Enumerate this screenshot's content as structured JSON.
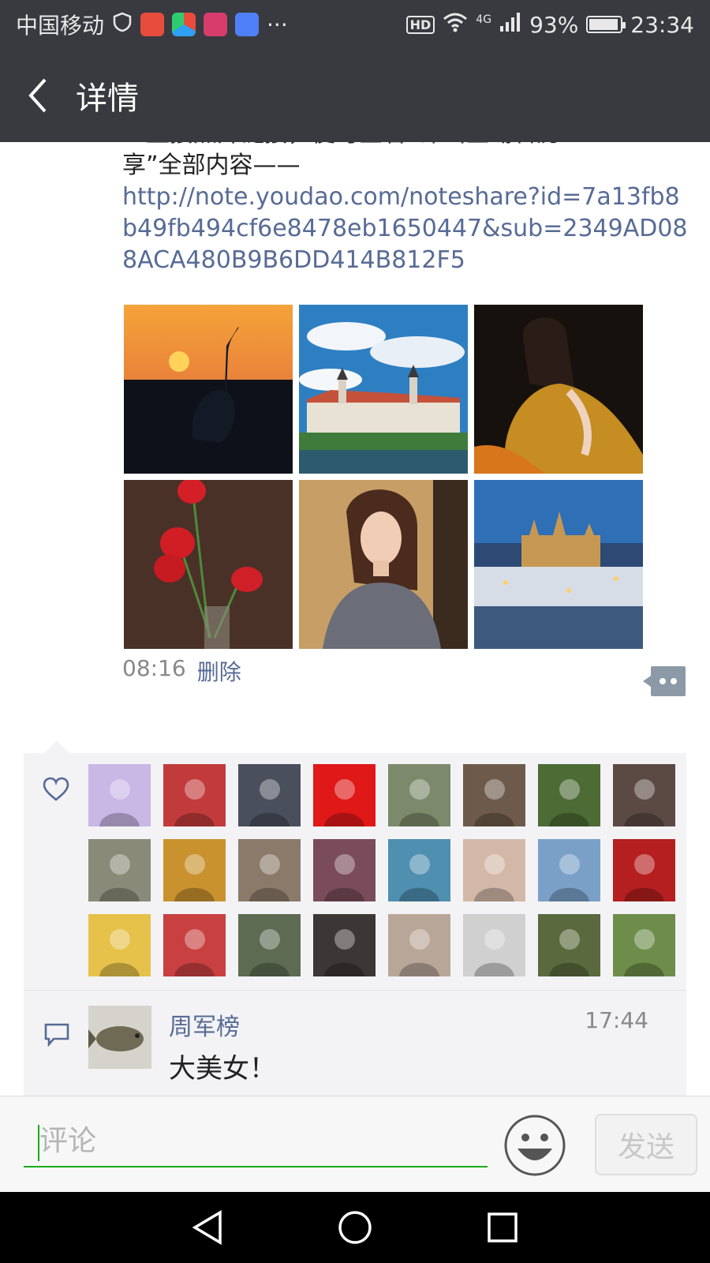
{
  "status_bar": {
    "carrier": "中国移动",
    "more": "···",
    "hd": "HD",
    "network": "4G",
    "battery": "93%",
    "time": "23:34",
    "app_colors": [
      "#e84c3d",
      "#2ea1f2",
      "#d63c6c",
      "#4f80f7"
    ]
  },
  "header": {
    "title": "详情"
  },
  "post": {
    "text_top": "一直接点开链接，便可查看“评出全場省历",
    "text_line2": "享”全部内容——",
    "link": "http://note.youdao.com/noteshare?id=7a13fb8b49fb494cf6e8478eb1650447&sub=2349AD088ACA480B9B6DD414B812F5",
    "photos": [
      {
        "name": "crane-sunset"
      },
      {
        "name": "castle-lake"
      },
      {
        "name": "woman-yellow-dress"
      },
      {
        "name": "red-tulips"
      },
      {
        "name": "woman-portrait"
      },
      {
        "name": "prague-castle-night"
      }
    ],
    "time": "08:16",
    "delete_label": "删除"
  },
  "likes": {
    "avatar_colors": [
      "#c9b7e6",
      "#c23b3b",
      "#4a4f5c",
      "#e01818",
      "#7c8a6b",
      "#6e5a4a",
      "#4d6b35",
      "#5b4a44",
      "#8a8a78",
      "#c9922f",
      "#8b7a6a",
      "#7a4c5b",
      "#4f8fb0",
      "#d3b8a8",
      "#7aa0c8",
      "#b51f1f",
      "#e6c24a",
      "#c84040",
      "#5d6b52",
      "#3c3636",
      "#b8a698",
      "#d0d0d0",
      "#5a6a3e",
      "#6e8d4a"
    ]
  },
  "comment": {
    "name": "周军榜",
    "time": "17:44",
    "text": "大美女！"
  },
  "input": {
    "placeholder": "评论",
    "send_label": "发送"
  },
  "colors": {
    "header_bg": "#393a3f",
    "link": "#576b95",
    "accent": "#1aad19"
  }
}
